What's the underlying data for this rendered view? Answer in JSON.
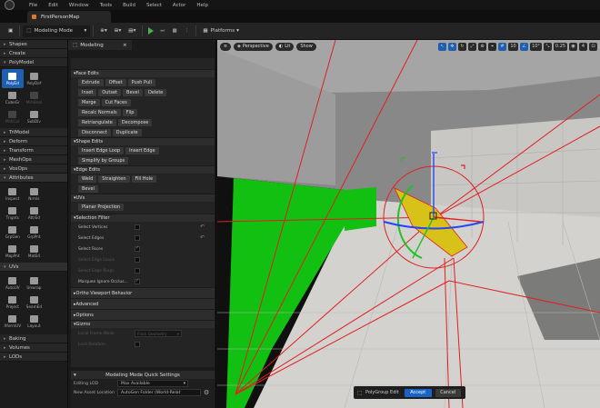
{
  "menubar": {
    "items": [
      "File",
      "Edit",
      "Window",
      "Tools",
      "Build",
      "Select",
      "Actor",
      "Help"
    ]
  },
  "level_tab": {
    "label": "FirstPersonMap"
  },
  "toolbar": {
    "mode_label": "Modeling Mode",
    "platforms_label": "Platforms"
  },
  "mode_panel": {
    "categories_top": [
      "Shapes",
      "Create",
      "PolyModel"
    ],
    "polymodel_tools": [
      {
        "label": "PolyEd",
        "state": "active"
      },
      {
        "label": "PolyDef",
        "state": "normal"
      },
      {
        "label": "CubeGr",
        "state": "normal"
      },
      {
        "label": "MshBool",
        "state": "dim"
      },
      {
        "label": "MshCut",
        "state": "dim"
      },
      {
        "label": "SubDiv",
        "state": "normal"
      }
    ],
    "categories_mid": [
      "TriModel",
      "Deform",
      "Transform",
      "MeshOps",
      "VoxOps",
      "Attributes"
    ],
    "attribute_tools": [
      "Inspect",
      "Nrmls",
      "Tngnts",
      "AttrEd",
      "GrpGen",
      "GrpPnt",
      "MapPnt",
      "MatEd"
    ],
    "uvs_category": "UVs",
    "uv_tools": [
      "AutoUV",
      "Unwrap",
      "Project",
      "SeamEd",
      "XformUV",
      "Layout"
    ],
    "categories_bottom": [
      "Baking",
      "Volumes",
      "LODs"
    ]
  },
  "details": {
    "tab_label": "Modeling",
    "face_edits": {
      "title": "Face Edits",
      "rows": [
        [
          "Extrude",
          "Offset",
          "Push Pull"
        ],
        [
          "Inset",
          "Outset",
          "Bevel",
          "Delete"
        ],
        [
          "Merge",
          "Cut Faces"
        ],
        [
          "Recalc Normals",
          "Flip"
        ],
        [
          "Retriangulate",
          "Decompose"
        ],
        [
          "Disconnect",
          "Duplicate"
        ]
      ]
    },
    "shape_edits": {
      "title": "Shape Edits",
      "rows": [
        [
          "Insert Edge Loop",
          "Insert Edge"
        ],
        [
          "Simplify by Groups"
        ]
      ]
    },
    "edge_edits": {
      "title": "Edge Edits",
      "rows": [
        [
          "Weld",
          "Straighten",
          "Fill Hole"
        ],
        [
          "Bevel"
        ]
      ]
    },
    "uvs": {
      "title": "UVs",
      "rows": [
        [
          "Planar Projection"
        ]
      ]
    },
    "selection_filter": {
      "title": "Selection Filter",
      "rows": [
        {
          "label": "Select Vertices",
          "checked": false,
          "dim": false,
          "reset": true
        },
        {
          "label": "Select Edges",
          "checked": false,
          "dim": false,
          "reset": true
        },
        {
          "label": "Select Faces",
          "checked": true,
          "dim": false,
          "reset": false
        },
        {
          "label": "Select Edge Loops",
          "checked": false,
          "dim": true,
          "reset": false
        },
        {
          "label": "Select Edge Rings",
          "checked": false,
          "dim": true,
          "reset": false
        },
        {
          "label": "Marquee Ignore Occlus...",
          "checked": true,
          "dim": false,
          "reset": false
        }
      ]
    },
    "collapsed_sections": [
      "Ortho Viewport Behavior",
      "Advanced",
      "Options"
    ],
    "gizmo": {
      "title": "Gizmo",
      "local_frame_label": "Local Frame Mode",
      "local_frame_value": "From Geometry",
      "lock_rotation_label": "Lock Rotation"
    }
  },
  "quick_settings": {
    "title": "Modeling Mode Quick Settings",
    "editing_lod_label": "Editing LOD",
    "editing_lod_value": "Max Available",
    "asset_location_label": "New Asset Location",
    "asset_location_value": "AutoGen Folder (World-Relat"
  },
  "viewport": {
    "perspective_label": "Perspective",
    "lit_label": "Lit",
    "show_label": "Show",
    "grid_snap": "10",
    "angle_snap": "10°",
    "scale_snap": "0.25",
    "camera_speed": "4"
  },
  "accept_bar": {
    "label": "PolyGroup Edit",
    "accept": "Accept",
    "cancel": "Cancel"
  },
  "colors": {
    "accent_blue": "#1f5fb0",
    "accept_blue": "#1a63c6",
    "gizmo_red": "#e02020",
    "gizmo_green": "#22c022",
    "gizmo_blue": "#2244ff",
    "selection_yellow": "#d8c21a",
    "wall_green": "#12c012"
  }
}
